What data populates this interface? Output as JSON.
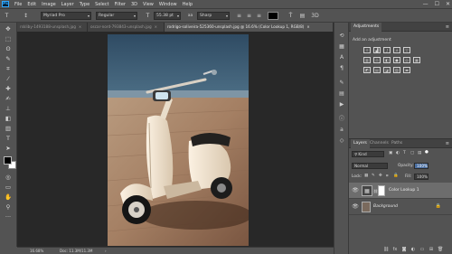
{
  "app": {
    "logo": "Ps"
  },
  "menu": [
    "File",
    "Edit",
    "Image",
    "Layer",
    "Type",
    "Select",
    "Filter",
    "3D",
    "View",
    "Window",
    "Help"
  ],
  "window_controls": {
    "minimize": "—",
    "maximize": "☐",
    "close": "✕"
  },
  "options_bar": {
    "font_family": "Myriad Pro",
    "font_style": "Regular",
    "font_size": "55.38 pt",
    "anti_alias_prefix": "aa",
    "anti_alias": "Sharp",
    "text_color": "#000000"
  },
  "tabs": [
    {
      "label": "rskliby-1493188-unsplash.jpg"
    },
    {
      "label": "oscar-nord-793843-unsplash.jpg"
    },
    {
      "label": "rodrigo-soliveira-525360-unsplash.jpg @ 16.6% (Color Lookup 1, RGB/8)"
    }
  ],
  "tab_close": "×",
  "status": {
    "zoom": "16.68%",
    "doc": "Doc: 11.3M/11.3M",
    "arrow": "›"
  },
  "adjustments": {
    "tab_label": "Adjustments",
    "add_label": "Add an adjustment"
  },
  "layers": {
    "tabs": [
      "Layers",
      "Channels",
      "Paths"
    ],
    "kind_label": "Kind",
    "blend_mode": "Normal",
    "opacity_label": "Opacity:",
    "opacity_value": "100%",
    "lock_label": "Lock:",
    "fill_label": "Fill:",
    "fill_value": "100%",
    "items": [
      {
        "name": "Color Lookup 1",
        "selected": true
      },
      {
        "name": "Background",
        "selected": false
      }
    ]
  },
  "colors": {
    "foreground": "#000000",
    "background": "#ffffff",
    "ps_blue": "#31a8ff"
  }
}
